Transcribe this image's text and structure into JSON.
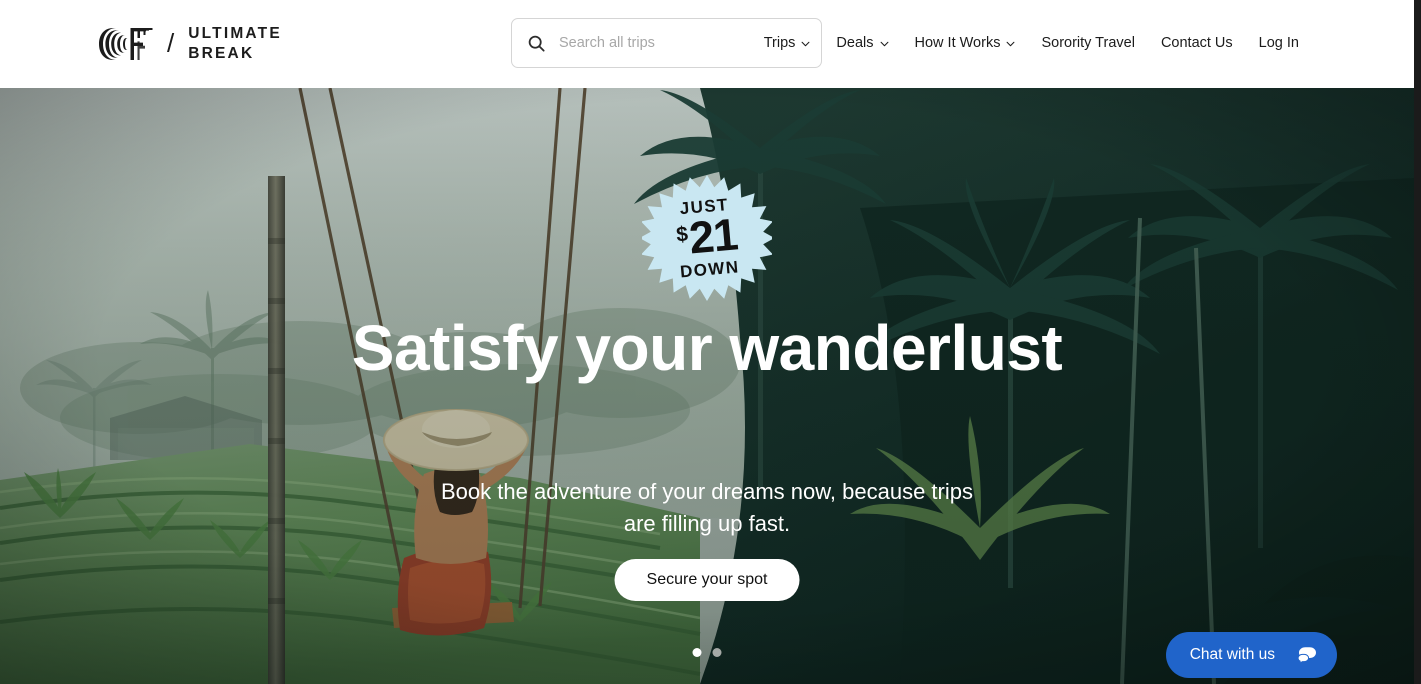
{
  "header": {
    "logo": {
      "mark": "ef-logo-icon",
      "divider": "/",
      "line1": "ULTIMATE",
      "line2": "BREAK"
    },
    "search": {
      "icon": "search-icon",
      "placeholder": "Search all trips",
      "value": ""
    },
    "nav": [
      {
        "label": "Trips",
        "has_dropdown": true
      },
      {
        "label": "Deals",
        "has_dropdown": true
      },
      {
        "label": "How It Works",
        "has_dropdown": true
      },
      {
        "label": "Sorority Travel",
        "has_dropdown": false
      },
      {
        "label": "Contact Us",
        "has_dropdown": false
      },
      {
        "label": "Log In",
        "has_dropdown": false
      }
    ]
  },
  "hero": {
    "badge": {
      "top": "JUST",
      "currency": "$",
      "amount": "21",
      "bottom": "DOWN"
    },
    "title": "Satisfy your wanderlust",
    "subtitle": "Book the adventure of your dreams now, because trips are filling up fast.",
    "cta_label": "Secure your spot",
    "carousel": {
      "slide_count": 2,
      "active_index": 0
    },
    "scene_description": "Woman in a wide-brim sun hat on a rope swing over misty tropical rice terraces with palm trees"
  },
  "chat": {
    "label": "Chat with us",
    "icon": "chat-bubble-icon"
  },
  "colors": {
    "badge_background": "#c9e7f2",
    "badge_text": "#111111",
    "chat_background": "#2064ca",
    "cta_background": "#ffffff",
    "cta_text": "#111111",
    "header_background": "#ffffff",
    "nav_text": "#1c1c1c",
    "dot_active": "#ffffff",
    "dot_inactive": "#a5a9a6"
  }
}
